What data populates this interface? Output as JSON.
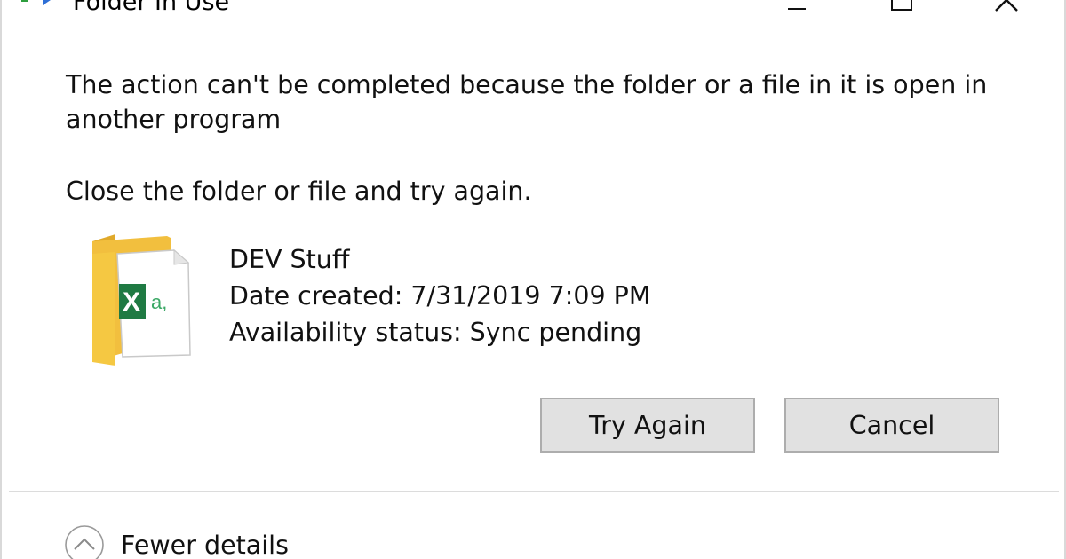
{
  "window": {
    "title": "Folder In Use",
    "controls": [
      "minimize-icon",
      "maximize-icon",
      "close-icon"
    ]
  },
  "message": {
    "main": "The action can't be completed because the folder or a file in it is open in another program",
    "instruction": "Close the folder or file and try again."
  },
  "file": {
    "icon": "folder-with-excel-file-icon",
    "name": "DEV Stuff",
    "date_created": "Date created: 7/31/2019 7:09 PM",
    "availability": "Availability status: Sync pending"
  },
  "buttons": {
    "try_again": "Try Again",
    "cancel": "Cancel"
  },
  "details": {
    "label": "Fewer details",
    "icon": "chevron-up-circle-icon"
  },
  "colors": {
    "folder": "#f5c842",
    "excel_green": "#1f7a43",
    "button_bg": "#e1e1e1",
    "button_border": "#adadad"
  }
}
